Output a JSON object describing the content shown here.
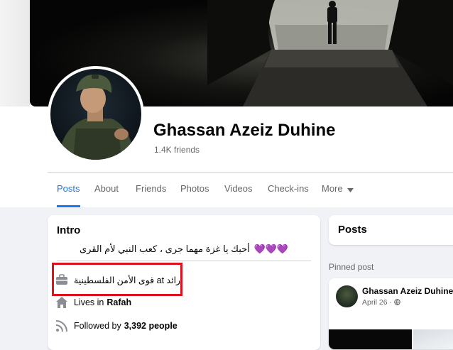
{
  "profile": {
    "name": "Ghassan Azeiz Duhine",
    "friends": "1.4K friends"
  },
  "tabs": [
    {
      "label": "Posts",
      "active": true
    },
    {
      "label": "About"
    },
    {
      "label": "Friends"
    },
    {
      "label": "Photos"
    },
    {
      "label": "Videos"
    },
    {
      "label": "Check-ins"
    },
    {
      "label": "More"
    }
  ],
  "intro": {
    "title": "Intro",
    "bio": "أحبك يا غزة مهما جرى ، كعب النبي لأم القرى",
    "bio_emoji": "💜💜💜",
    "work": "رائد at قوى الأمن الفلسطينية",
    "lives_prefix": "Lives in",
    "lives_place": "Rafah",
    "followed_prefix": "Followed by",
    "followed_count": "3,392 people"
  },
  "posts": {
    "title": "Posts",
    "pinned_label": "Pinned post",
    "pinned_author": "Ghassan Azeiz Duhine",
    "pinned_date": "April 26 ·"
  },
  "colors": {
    "accent": "#1877f2",
    "highlight": "#e0101c",
    "text_secondary": "#65676b"
  },
  "icons": {
    "work": "briefcase-icon",
    "home": "home-icon",
    "followers": "rss-icon",
    "privacy": "globe-icon",
    "more": "chevron-down-icon"
  }
}
